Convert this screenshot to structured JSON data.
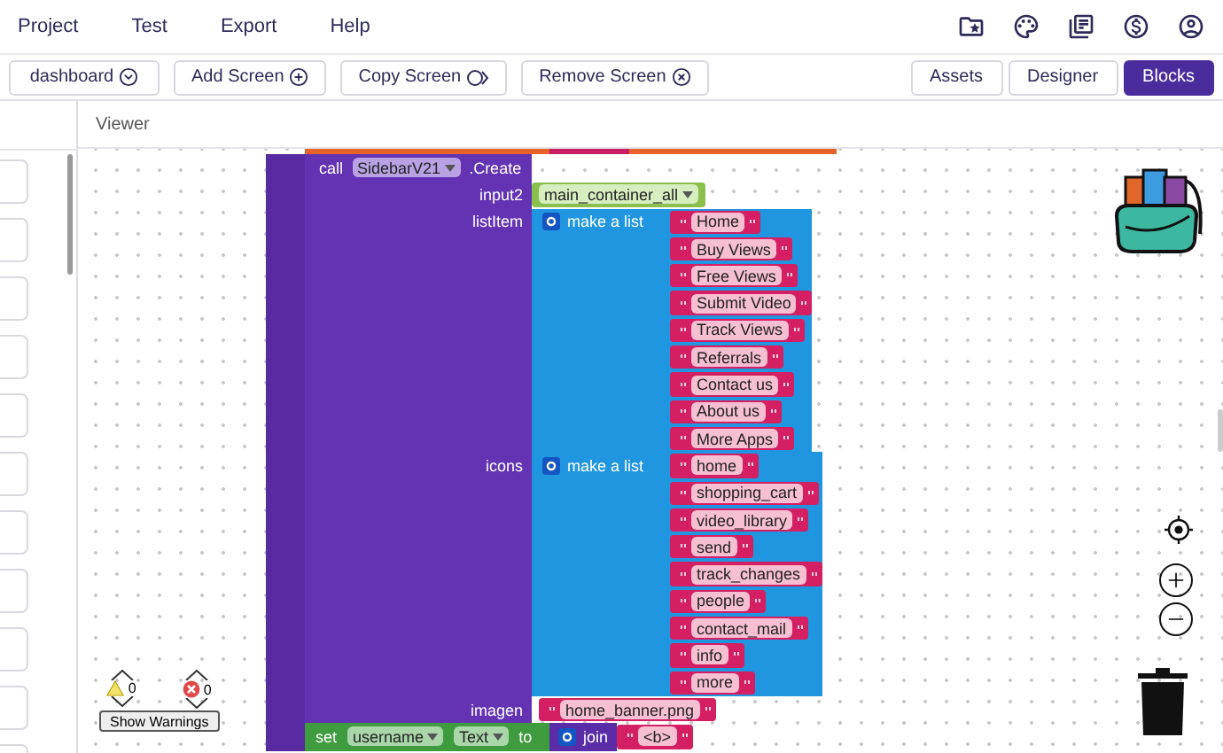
{
  "menu": [
    "Project",
    "Test",
    "Export",
    "Help"
  ],
  "toolbar": {
    "screen_select": "dashboard",
    "actions": [
      {
        "label": "Add Screen",
        "kind": "add"
      },
      {
        "label": "Copy Screen",
        "kind": "copy"
      },
      {
        "label": "Remove Screen",
        "kind": "remove"
      }
    ],
    "views": [
      {
        "label": "Assets",
        "selected": false
      },
      {
        "label": "Designer",
        "selected": false
      },
      {
        "label": "Blocks",
        "selected": true
      }
    ]
  },
  "viewer": {
    "title": "Viewer"
  },
  "blocks": {
    "call": {
      "keyword": "call",
      "component": "SidebarV21",
      "method": ".Create",
      "sockets": [
        {
          "label": "input2",
          "kind": "component",
          "value": "main_container_all"
        },
        {
          "label": "listItem",
          "kind": "list",
          "list_label": "make a list",
          "items": [
            "Home",
            "Buy Views",
            "Free Views",
            "Submit Video",
            "Track Views",
            "Referrals",
            "Contact us",
            "About us",
            "More Apps"
          ]
        },
        {
          "label": "icons",
          "kind": "list",
          "list_label": "make a list",
          "items": [
            "home",
            "shopping_cart",
            "video_library",
            "send",
            "track_changes",
            "people",
            "contact_mail",
            "info",
            "more"
          ]
        },
        {
          "label": "imagen",
          "kind": "text",
          "value": "home_banner.png"
        }
      ]
    },
    "set": {
      "keyword": "set",
      "component": "username",
      "property": "Text",
      "to": "to",
      "join": "join",
      "text": "<b>"
    }
  },
  "warnings": {
    "warning_count": "0",
    "error_count": "0",
    "button": "Show Warnings"
  }
}
